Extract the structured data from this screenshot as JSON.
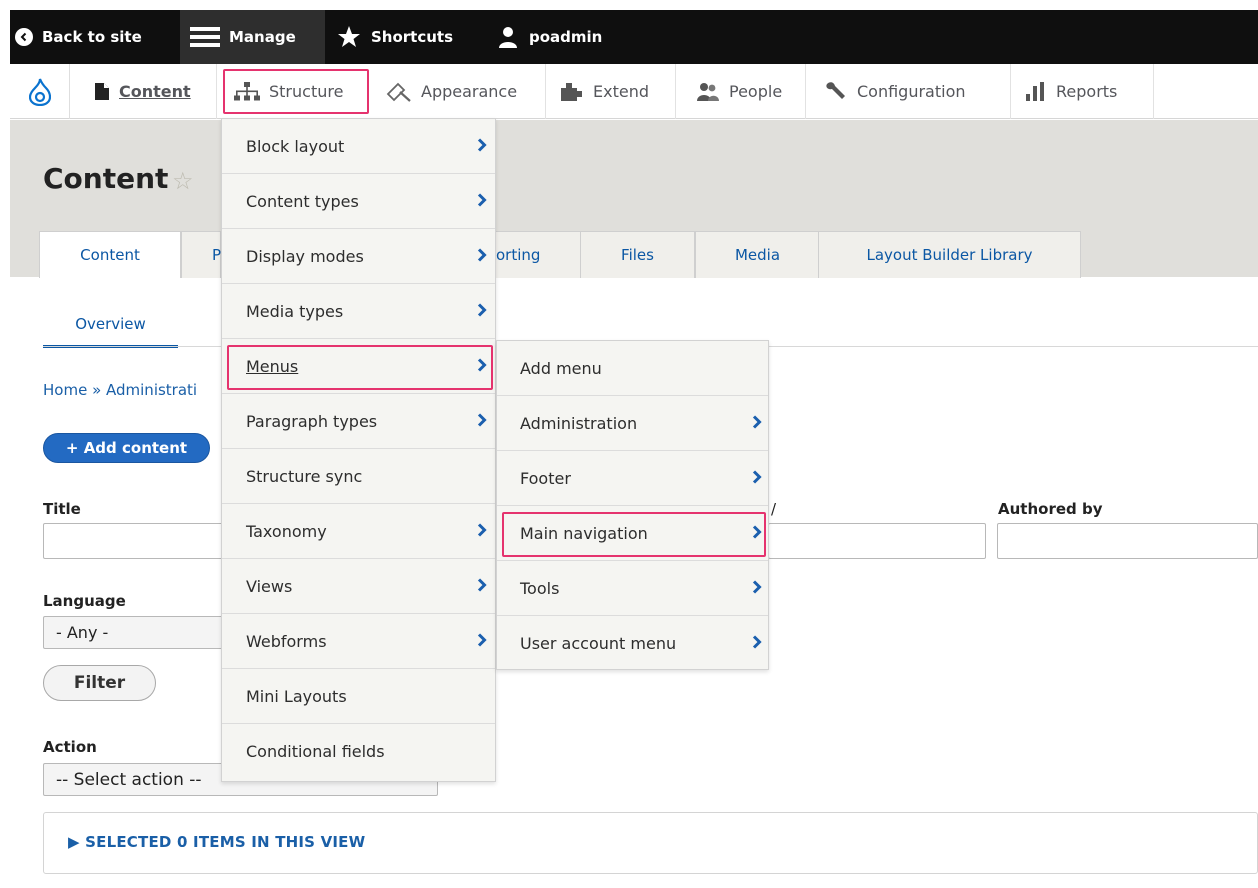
{
  "toolbar": {
    "back_label": "Back to site",
    "manage_label": "Manage",
    "shortcuts_label": "Shortcuts",
    "user_label": "poadmin"
  },
  "tray": {
    "items": [
      {
        "label": "Content",
        "icon": "file-icon"
      },
      {
        "label": "Structure",
        "icon": "sitemap-icon"
      },
      {
        "label": "Appearance",
        "icon": "paint-brush-icon"
      },
      {
        "label": "Extend",
        "icon": "puzzle-icon"
      },
      {
        "label": "People",
        "icon": "people-icon"
      },
      {
        "label": "Configuration",
        "icon": "wrench-icon"
      },
      {
        "label": "Reports",
        "icon": "bar-chart-icon"
      }
    ]
  },
  "page": {
    "title": "Content",
    "tabs": [
      "Content",
      "P",
      "orting",
      "Files",
      "Media",
      "Layout Builder Library"
    ],
    "subtab": "Overview",
    "breadcrumb": "Home » Administrati",
    "add_button": "+ Add content"
  },
  "filters": {
    "title_label": "Title",
    "title_value": "",
    "authored_label": "Authored by",
    "authored_value": "",
    "partial_label": "/",
    "language_label": "Language",
    "language_value": "- Any -",
    "filter_button": "Filter",
    "action_label": "Action",
    "action_value": "-- Select action --"
  },
  "bulk": {
    "selected_text": "▶  SELECTED 0 ITEMS IN THIS VIEW"
  },
  "structure_menu": {
    "items": [
      {
        "label": "Block layout",
        "has_children": true
      },
      {
        "label": "Content types",
        "has_children": true
      },
      {
        "label": "Display modes",
        "has_children": true
      },
      {
        "label": "Media types",
        "has_children": true
      },
      {
        "label": "Menus",
        "has_children": true,
        "highlighted": true
      },
      {
        "label": "Paragraph types",
        "has_children": true
      },
      {
        "label": "Structure sync",
        "has_children": false
      },
      {
        "label": "Taxonomy",
        "has_children": true
      },
      {
        "label": "Views",
        "has_children": true
      },
      {
        "label": "Webforms",
        "has_children": true
      },
      {
        "label": "Mini Layouts",
        "has_children": false
      },
      {
        "label": "Conditional fields",
        "has_children": false
      }
    ]
  },
  "menus_submenu": {
    "items": [
      {
        "label": "Add menu",
        "has_children": false
      },
      {
        "label": "Administration",
        "has_children": true
      },
      {
        "label": "Footer",
        "has_children": true
      },
      {
        "label": "Main navigation",
        "has_children": true,
        "highlighted": true
      },
      {
        "label": "Tools",
        "has_children": true
      },
      {
        "label": "User account menu",
        "has_children": true
      }
    ]
  },
  "colors": {
    "toolbar_bg": "#0f0f0f",
    "highlight": "#e5336e",
    "link_blue": "#0b57a4",
    "primary_button": "#236ac2",
    "chevron_blue": "#1b5fae"
  }
}
